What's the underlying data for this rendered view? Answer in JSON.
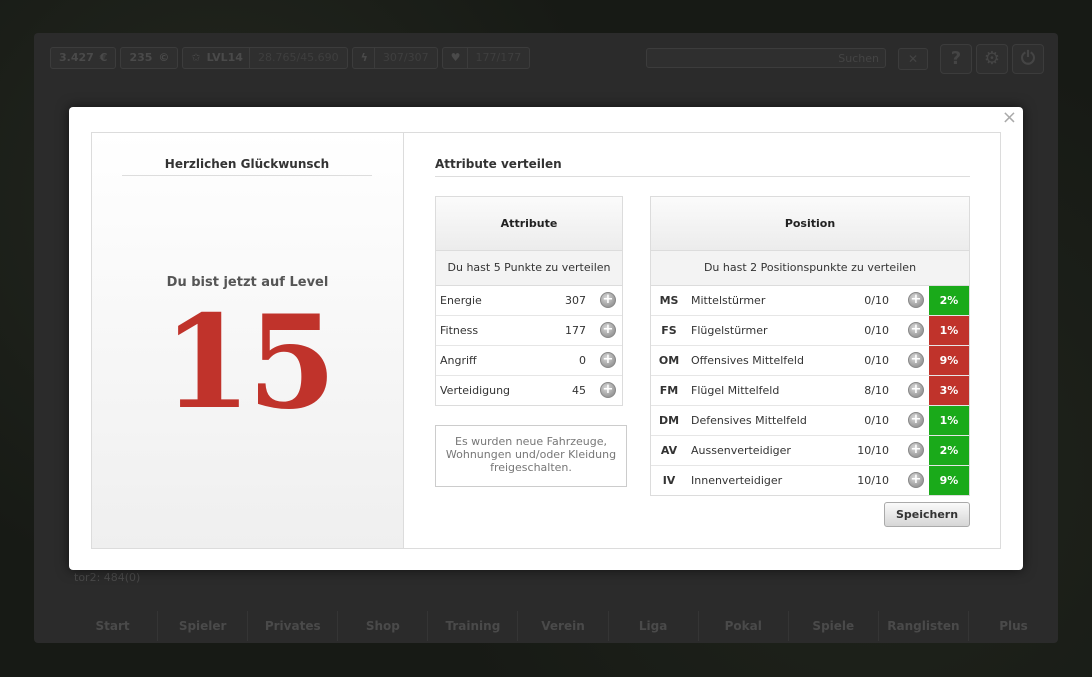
{
  "topbar": {
    "money": "3.427",
    "money_icon": "euro-coin-icon",
    "credits": "235",
    "credits_icon": "credit-coin-icon",
    "level": "LVL14",
    "xp": "28.765/45.690",
    "energy": "307/307",
    "health": "177/177",
    "search_label": "Suchen"
  },
  "background": {
    "status_line": "tor2: 484(0)",
    "nav": [
      "Start",
      "Spieler",
      "Privates",
      "Shop",
      "Training",
      "Verein",
      "Liga",
      "Pokal",
      "Spiele",
      "Ranglisten",
      "Plus"
    ]
  },
  "modal": {
    "congrats_title": "Herzlichen Glückwunsch",
    "level_text": "Du bist jetzt auf Level",
    "level_number": "15",
    "section_title": "Attribute verteilen",
    "attributes": {
      "header": "Attribute",
      "points_info": "Du hast 5 Punkte zu verteilen",
      "rows": [
        {
          "name": "Energie",
          "value": "307"
        },
        {
          "name": "Fitness",
          "value": "177"
        },
        {
          "name": "Angriff",
          "value": "0"
        },
        {
          "name": "Verteidigung",
          "value": "45"
        }
      ]
    },
    "unlock_text": "Es wurden neue Fahrzeuge, Wohnungen und/oder Kleidung freigeschalten.",
    "positions": {
      "header": "Position",
      "points_info": "Du hast 2 Positionspunkte zu verteilen",
      "rows": [
        {
          "abbr": "MS",
          "name": "Mittelstürmer",
          "value": "0/10",
          "pct": "2%",
          "color": "#1aaa1a"
        },
        {
          "abbr": "FS",
          "name": "Flügelstürmer",
          "value": "0/10",
          "pct": "1%",
          "color": "#c0332b"
        },
        {
          "abbr": "OM",
          "name": "Offensives Mittelfeld",
          "value": "0/10",
          "pct": "9%",
          "color": "#c0332b"
        },
        {
          "abbr": "FM",
          "name": "Flügel Mittelfeld",
          "value": "8/10",
          "pct": "3%",
          "color": "#c0332b"
        },
        {
          "abbr": "DM",
          "name": "Defensives Mittelfeld",
          "value": "0/10",
          "pct": "1%",
          "color": "#1aaa1a"
        },
        {
          "abbr": "AV",
          "name": "Aussenverteidiger",
          "value": "10/10",
          "pct": "2%",
          "color": "#1aaa1a"
        },
        {
          "abbr": "IV",
          "name": "Innenverteidiger",
          "value": "10/10",
          "pct": "9%",
          "color": "#1aaa1a"
        }
      ]
    },
    "save_label": "Speichern"
  }
}
